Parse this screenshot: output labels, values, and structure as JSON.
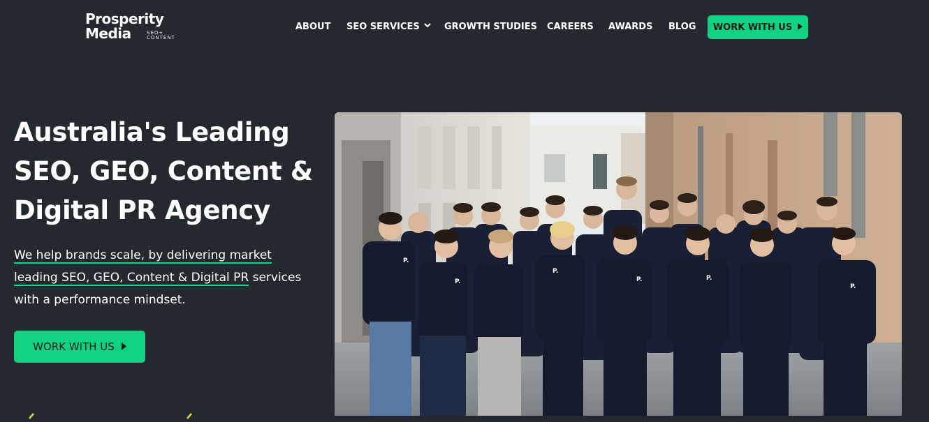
{
  "brand": {
    "name_line1": "Prosperity",
    "name_line2": "Media",
    "tagline_line1": "SEO+",
    "tagline_line2": "CONTENT"
  },
  "nav": {
    "items": [
      {
        "label": "ABOUT"
      },
      {
        "label": "SEO SERVICES",
        "has_dropdown": true
      },
      {
        "label": "GROWTH STUDIES"
      },
      {
        "label": "CAREERS"
      },
      {
        "label": "AWARDS"
      },
      {
        "label": "BLOG"
      }
    ],
    "cta_label": "WORK WITH US"
  },
  "hero": {
    "title": "Australia's Leading SEO, GEO, Content & Digital PR Agency",
    "subtitle_link": "We help brands scale, by delivering market leading SEO, GEO, Content & Digital PR",
    "subtitle_rest": " services with a performance mindset.",
    "cta_label": "WORK WITH US"
  },
  "colors": {
    "background": "#23292f",
    "accent": "#10d282",
    "cta_text": "#0f1d19",
    "text": "#ffffff"
  },
  "icons": {
    "nav_dropdown": "chevron-down-icon",
    "cta_arrow": "play-arrow-icon"
  }
}
